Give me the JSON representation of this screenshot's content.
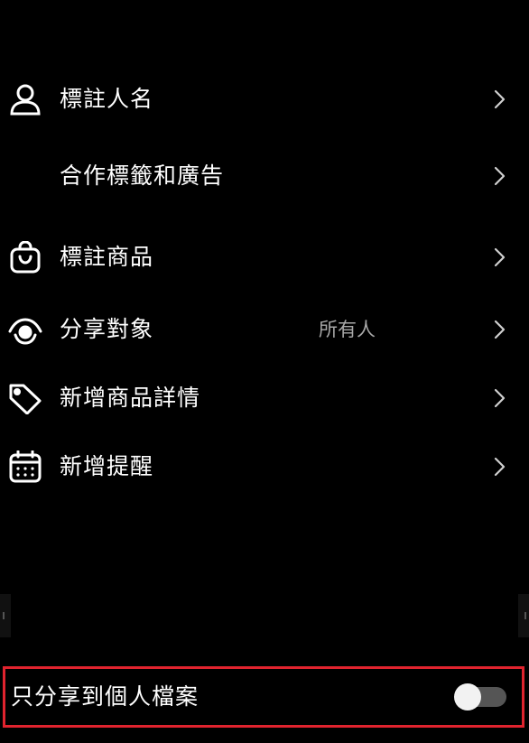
{
  "menu": {
    "tag_people": {
      "label": "標註人名",
      "icon": "person-icon"
    },
    "partnership_ads": {
      "label": "合作標籤和廣告"
    },
    "tag_products": {
      "label": "標註商品",
      "icon": "shopping-bag-icon"
    },
    "audience": {
      "label": "分享對象",
      "value": "所有人",
      "icon": "eye-icon"
    },
    "add_product_details": {
      "label": "新增商品詳情",
      "icon": "tag-icon"
    },
    "add_reminder": {
      "label": "新增提醒",
      "icon": "calendar-icon"
    }
  },
  "profile_only": {
    "label": "只分享到個人檔案",
    "enabled": false
  },
  "colors": {
    "background": "#000000",
    "text": "#ffffff",
    "secondary_text": "#a8a8a8",
    "toggle_track_off": "#555555",
    "toggle_knob": "#f2f2f2",
    "highlight_border": "#e0232e"
  }
}
